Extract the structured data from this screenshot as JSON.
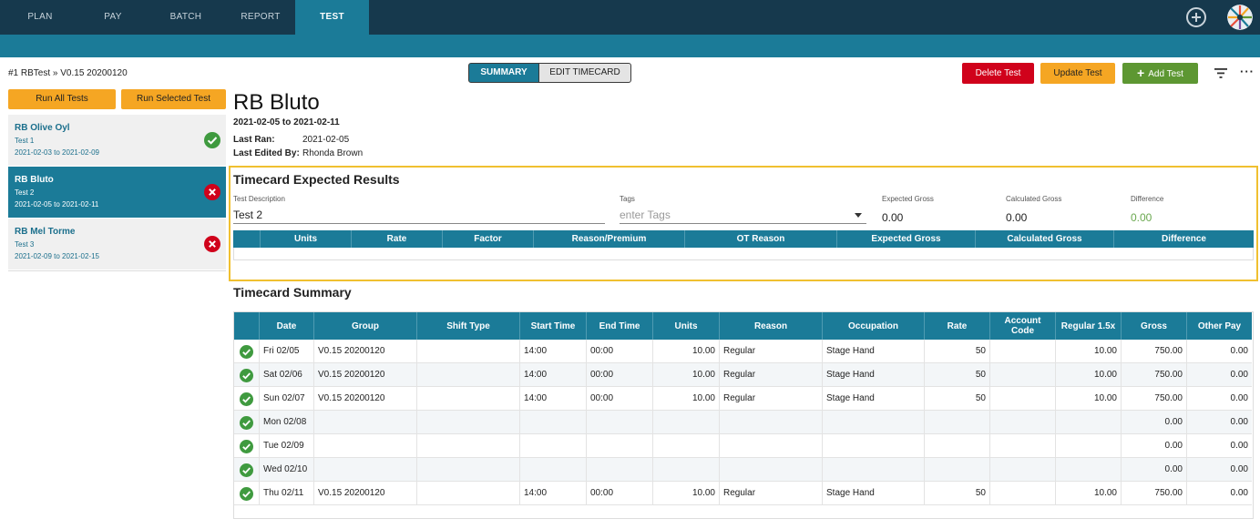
{
  "nav": {
    "tabs": [
      {
        "label": "PLAN"
      },
      {
        "label": "PAY"
      },
      {
        "label": "BATCH"
      },
      {
        "label": "REPORT"
      },
      {
        "label": "TEST"
      }
    ],
    "active_tab": "TEST"
  },
  "breadcrumb": "#1 RBTest  »  V0.15 20200120",
  "view_toggle": {
    "summary": "SUMMARY",
    "edit_timecard": "EDIT TIMECARD"
  },
  "actions": {
    "delete": "Delete Test",
    "update": "Update Test",
    "add": "Add Test"
  },
  "sidebar": {
    "run_all": "Run All Tests",
    "run_selected": "Run Selected Test",
    "tests": [
      {
        "name": "RB Olive Oyl",
        "label": "Test 1",
        "dates": "2021-02-03 to 2021-02-09",
        "status": "pass"
      },
      {
        "name": "RB Bluto",
        "label": "Test 2",
        "dates": "2021-02-05 to 2021-02-11",
        "status": "fail"
      },
      {
        "name": "RB Mel Torme",
        "label": "Test 3",
        "dates": "2021-02-09 to 2021-02-15",
        "status": "fail"
      }
    ]
  },
  "detail": {
    "title": "RB Bluto",
    "dates": "2021-02-05 to 2021-02-11",
    "last_ran_label": "Last Ran:",
    "last_ran": "2021-02-05",
    "last_edited_label": "Last Edited By:",
    "last_edited": "Rhonda Brown"
  },
  "expected": {
    "title": "Timecard Expected Results",
    "test_description_label": "Test Description",
    "test_description": "Test 2",
    "tags_label": "Tags",
    "tags_placeholder": "enter Tags",
    "expected_gross_label": "Expected Gross",
    "expected_gross": "0.00",
    "calculated_gross_label": "Calculated Gross",
    "calculated_gross": "0.00",
    "difference_label": "Difference",
    "difference": "0.00",
    "columns": [
      "Units",
      "Rate",
      "Factor",
      "Reason/Premium",
      "OT Reason",
      "Expected Gross",
      "Calculated Gross",
      "Difference"
    ]
  },
  "summary": {
    "title": "Timecard Summary",
    "columns": [
      "Date",
      "Group",
      "Shift Type",
      "Start Time",
      "End Time",
      "Units",
      "Reason",
      "Occupation",
      "Rate",
      "Account Code",
      "Regular 1.5x",
      "Gross",
      "Other Pay"
    ],
    "rows": [
      {
        "date": "Fri 02/05",
        "group": "V0.15 20200120",
        "shift": "",
        "start": "14:00",
        "end": "00:00",
        "units": "10.00",
        "reason": "Regular",
        "occupation": "Stage Hand",
        "rate": "50",
        "account": "",
        "reg15": "10.00",
        "gross": "750.00",
        "other": "0.00"
      },
      {
        "date": "Sat 02/06",
        "group": "V0.15 20200120",
        "shift": "",
        "start": "14:00",
        "end": "00:00",
        "units": "10.00",
        "reason": "Regular",
        "occupation": "Stage Hand",
        "rate": "50",
        "account": "",
        "reg15": "10.00",
        "gross": "750.00",
        "other": "0.00"
      },
      {
        "date": "Sun 02/07",
        "group": "V0.15 20200120",
        "shift": "",
        "start": "14:00",
        "end": "00:00",
        "units": "10.00",
        "reason": "Regular",
        "occupation": "Stage Hand",
        "rate": "50",
        "account": "",
        "reg15": "10.00",
        "gross": "750.00",
        "other": "0.00"
      },
      {
        "date": "Mon 02/08",
        "group": "",
        "shift": "",
        "start": "",
        "end": "",
        "units": "",
        "reason": "",
        "occupation": "",
        "rate": "",
        "account": "",
        "reg15": "",
        "gross": "0.00",
        "other": "0.00"
      },
      {
        "date": "Tue 02/09",
        "group": "",
        "shift": "",
        "start": "",
        "end": "",
        "units": "",
        "reason": "",
        "occupation": "",
        "rate": "",
        "account": "",
        "reg15": "",
        "gross": "0.00",
        "other": "0.00"
      },
      {
        "date": "Wed 02/10",
        "group": "",
        "shift": "",
        "start": "",
        "end": "",
        "units": "",
        "reason": "",
        "occupation": "",
        "rate": "",
        "account": "",
        "reg15": "",
        "gross": "0.00",
        "other": "0.00"
      },
      {
        "date": "Thu 02/11",
        "group": "V0.15 20200120",
        "shift": "",
        "start": "14:00",
        "end": "00:00",
        "units": "10.00",
        "reason": "Regular",
        "occupation": "Stage Hand",
        "rate": "50",
        "account": "",
        "reg15": "10.00",
        "gross": "750.00",
        "other": "0.00"
      }
    ]
  },
  "colors": {
    "nav": "#16394d",
    "accent": "#1b7b98",
    "delete": "#d0021b",
    "update": "#f5a623",
    "add": "#5d9732",
    "pass": "#3f9a3f",
    "fail": "#d0021b",
    "highlight": "#f0c030"
  }
}
